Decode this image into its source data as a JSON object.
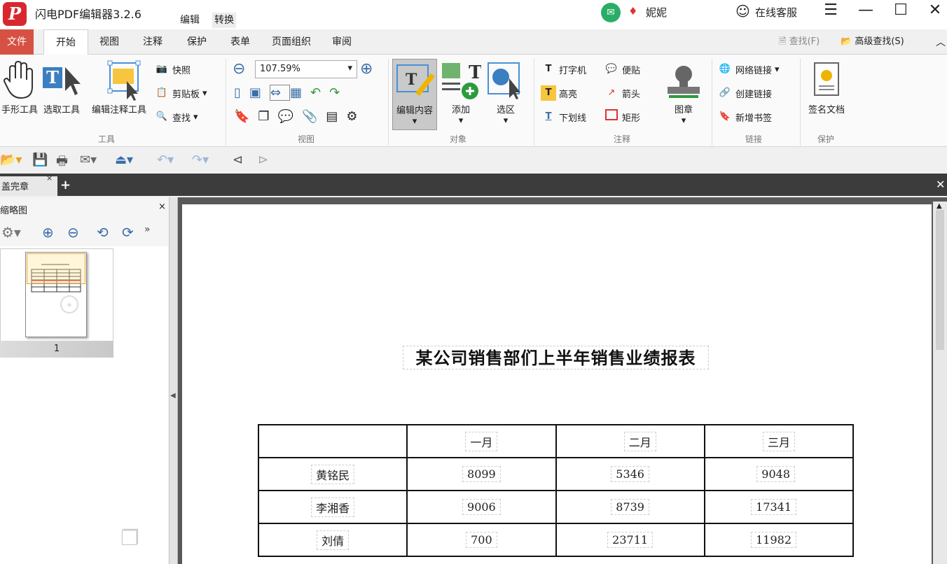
{
  "app": {
    "logo": "P",
    "title": "闪电PDF编辑器3.2.6"
  },
  "title_menu": {
    "edit": "编辑",
    "convert": "转换"
  },
  "user": {
    "name": "妮妮",
    "service": "在线客服"
  },
  "tabs": {
    "file": "文件",
    "home": "开始",
    "view": "视图",
    "annotate": "注释",
    "protect": "保护",
    "form": "表单",
    "page_org": "页面组织",
    "review": "审阅"
  },
  "search": {
    "find": "查找(F)",
    "advanced": "高级查找(S)"
  },
  "ribbon": {
    "tools": {
      "hand": "手形工具",
      "select": "选取工具",
      "edit_annot": "编辑注释工具",
      "snapshot": "快照",
      "clipboard": "剪贴板",
      "find": "查找",
      "group": "工具"
    },
    "view": {
      "zoom": "107.59%",
      "group": "视图"
    },
    "object": {
      "edit_content": "编辑内容",
      "add": "添加",
      "select_area": "选区",
      "group": "对象"
    },
    "annotation": {
      "typewriter": "打字机",
      "note": "便贴",
      "highlight": "高亮",
      "arrow": "箭头",
      "underline": "下划线",
      "rect": "矩形",
      "stamp": "图章",
      "group": "注释"
    },
    "link": {
      "web_link": "网络链接",
      "create_link": "创建链接",
      "add_bookmark": "新增书签",
      "group": "链接"
    },
    "protect": {
      "sign": "签名文档",
      "group": "保护"
    }
  },
  "doc_tab": {
    "label": "盖完章"
  },
  "panel": {
    "title": "缩略图",
    "page_number": "1"
  },
  "document": {
    "heading": "某公司销售部们上半年销售业绩报表",
    "table": {
      "headers": [
        "",
        "一月",
        "二月",
        "三月"
      ],
      "rows": [
        {
          "name": "黄铭民",
          "m1": "8099",
          "m2": "5346",
          "m3": "9048"
        },
        {
          "name": "李湘香",
          "m1": "9006",
          "m2": "8739",
          "m3": "17341"
        },
        {
          "name": "刘倩",
          "m1": "700",
          "m2": "23711",
          "m3": "11982"
        }
      ]
    }
  },
  "colors": {
    "brand": "#d8282f",
    "file_tab": "#d65143",
    "doc_background": "#595959"
  }
}
